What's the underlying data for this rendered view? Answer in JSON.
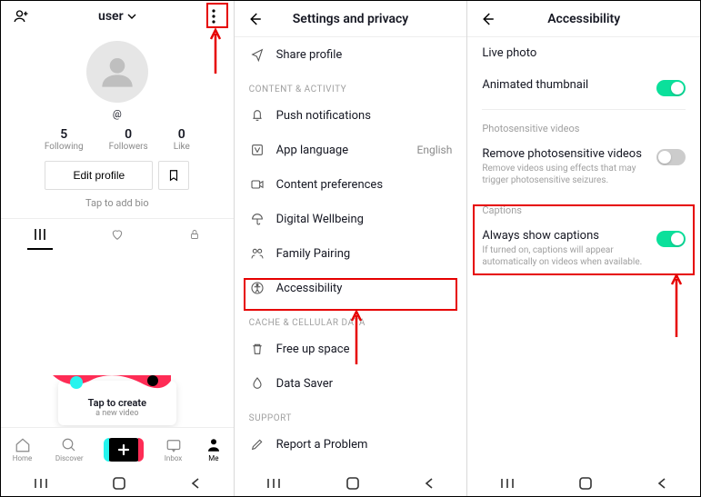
{
  "profile": {
    "username": "user",
    "handle": "@",
    "stats": [
      {
        "num": "5",
        "label": "Following"
      },
      {
        "num": "0",
        "label": "Followers"
      },
      {
        "num": "0",
        "label": "Like"
      }
    ],
    "edit_label": "Edit profile",
    "bio_prompt": "Tap to add bio",
    "create_title": "Tap to create",
    "create_sub": "a new video",
    "nav": [
      {
        "label": "Home"
      },
      {
        "label": "Discover"
      },
      {
        "label": "Inbox"
      },
      {
        "label": "Me"
      }
    ]
  },
  "settings": {
    "title": "Settings and privacy",
    "share_label": "Share profile",
    "sections": {
      "content": "CONTENT & ACTIVITY",
      "cache": "CACHE & CELLULAR DATA",
      "support": "SUPPORT"
    },
    "items": {
      "push": "Push notifications",
      "lang": "App language",
      "lang_val": "English",
      "pref": "Content preferences",
      "wellbeing": "Digital Wellbeing",
      "family": "Family Pairing",
      "accessibility": "Accessibility",
      "free": "Free up space",
      "saver": "Data Saver",
      "report": "Report a Problem"
    }
  },
  "accessibility": {
    "title": "Accessibility",
    "live_photo": "Live photo",
    "anim_thumb": "Animated thumbnail",
    "photo_hdr": "Photosensitive videos",
    "photo_title": "Remove photosensitive videos",
    "photo_sub": "Remove videos using effects that may trigger photosensitive seizures.",
    "captions_hdr": "Captions",
    "captions_title": "Always show captions",
    "captions_sub": "If turned on, captions will appear automatically on videos when available."
  }
}
